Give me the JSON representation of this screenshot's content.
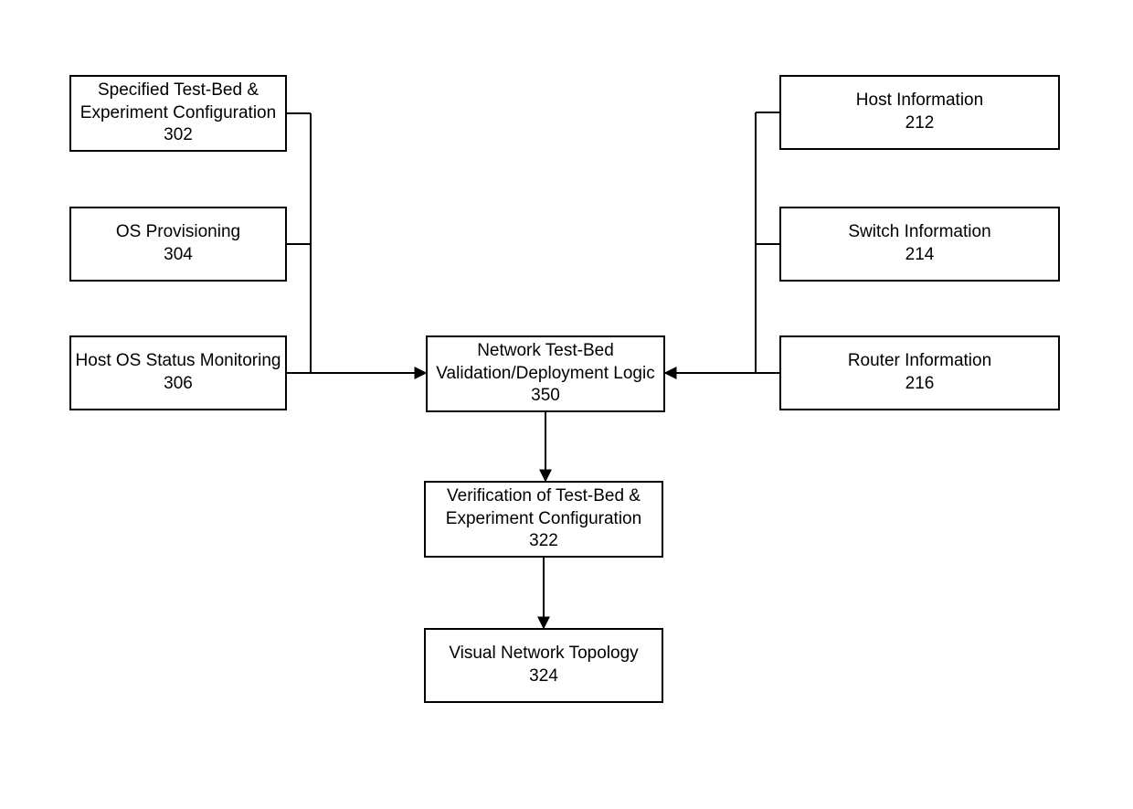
{
  "diagram": {
    "boxes": {
      "spec": {
        "title": "Specified Test-Bed & Experiment Configuration",
        "num": "302"
      },
      "osprov": {
        "title": "OS Provisioning",
        "num": "304"
      },
      "hostmon": {
        "title": "Host OS Status Monitoring",
        "num": "306"
      },
      "center": {
        "title": "Network Test-Bed Validation/Deployment Logic",
        "num": "350"
      },
      "hostinfo": {
        "title": "Host Information",
        "num": "212"
      },
      "swinfo": {
        "title": "Switch Information",
        "num": "214"
      },
      "rtrinfo": {
        "title": "Router Information",
        "num": "216"
      },
      "verify": {
        "title": "Verification of Test-Bed & Experiment Configuration",
        "num": "322"
      },
      "visual": {
        "title": "Visual Network Topology",
        "num": "324"
      }
    }
  }
}
